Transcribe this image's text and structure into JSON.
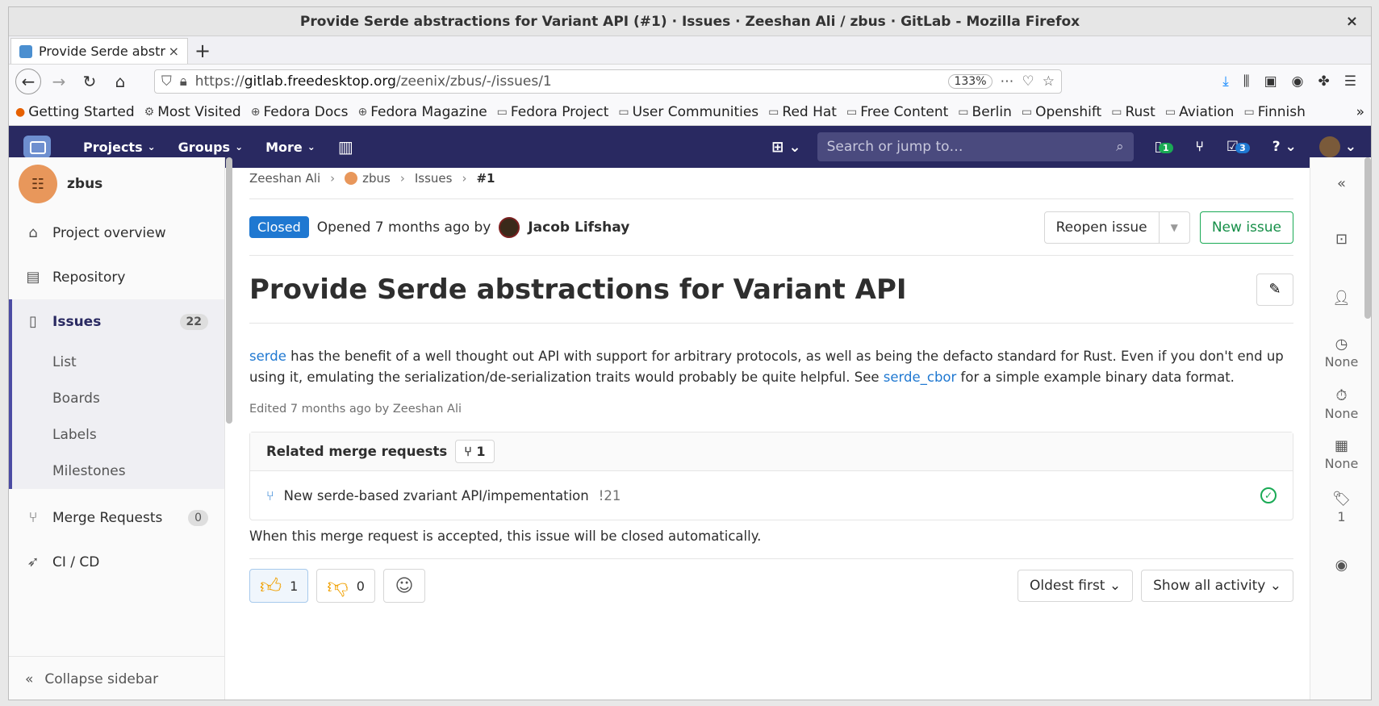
{
  "window": {
    "title": "Provide Serde abstractions for Variant API (#1) · Issues · Zeeshan Ali / zbus · GitLab - Mozilla Firefox",
    "close": "×"
  },
  "tab": {
    "title": "Provide Serde abstr",
    "close": "×",
    "new": "+"
  },
  "nav": {
    "url_prefix": "https://",
    "url_host": "gitlab.freedesktop.org",
    "url_path": "/zeenix/zbus/-/issues/1",
    "zoom": "133%"
  },
  "bookmarks": [
    "Getting Started",
    "Most Visited",
    "Fedora Docs",
    "Fedora Magazine",
    "Fedora Project",
    "User Communities",
    "Red Hat",
    "Free Content",
    "Berlin",
    "Openshift",
    "Rust",
    "Aviation",
    "Finnish"
  ],
  "gitlab": {
    "menu": {
      "projects": "Projects",
      "groups": "Groups",
      "more": "More"
    },
    "search_placeholder": "Search or jump to…",
    "issues_badge": "1",
    "todos_badge": "3"
  },
  "sidebar": {
    "project": "zbus",
    "items": [
      {
        "label": "Project overview"
      },
      {
        "label": "Repository"
      },
      {
        "label": "Issues",
        "count": "22"
      },
      {
        "label": "Merge Requests",
        "count": "0"
      },
      {
        "label": "CI / CD"
      }
    ],
    "sub": [
      "List",
      "Boards",
      "Labels",
      "Milestones"
    ],
    "collapse": "Collapse sidebar"
  },
  "breadcrumbs": [
    "Zeeshan Ali",
    "zbus",
    "Issues",
    "#1"
  ],
  "issue": {
    "status": "Closed",
    "opened": "Opened 7 months ago by",
    "author": "Jacob Lifshay",
    "reopen": "Reopen issue",
    "new_issue": "New issue",
    "title": "Provide Serde abstractions for Variant API",
    "desc_link1": "serde",
    "desc_part1": " has the benefit of a well thought out API with support for arbitrary protocols, as well as being the defacto standard for Rust. Even if you don't end up using it, emulating the serialization/de-serialization traits would probably be quite helpful. See ",
    "desc_link2": "serde_cbor",
    "desc_part2": " for a simple example binary data format.",
    "edited": "Edited 7 months ago by Zeeshan Ali"
  },
  "related": {
    "heading": "Related merge requests",
    "count": "1",
    "mr_title": "New serde-based zvariant API/impementation",
    "mr_ref": "!21",
    "auto_close": "When this merge request is accepted, this issue will be closed automatically."
  },
  "awards": {
    "up": "1",
    "down": "0"
  },
  "sorting": {
    "order": "Oldest first",
    "filter": "Show all activity"
  },
  "rightbar": {
    "time1": "None",
    "time2": "None",
    "due": "None",
    "labels": "1"
  }
}
